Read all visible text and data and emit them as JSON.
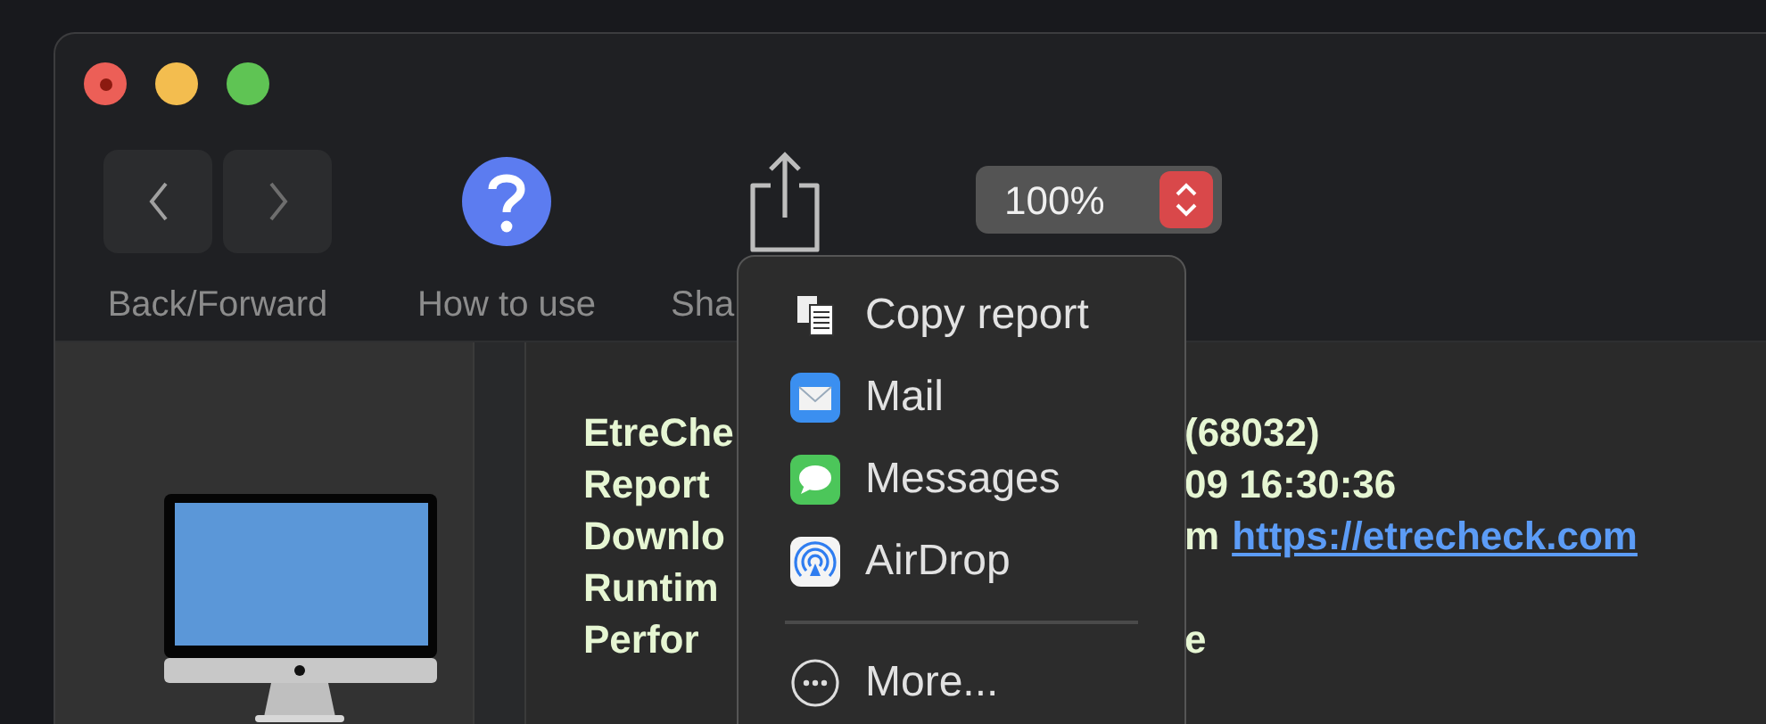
{
  "toolbar": {
    "items": [
      {
        "kind": "nav",
        "label": "Back/Forward"
      },
      {
        "kind": "help",
        "label": "How to use"
      },
      {
        "kind": "share",
        "label": "Sha"
      },
      {
        "kind": "zoom",
        "value": "100%"
      }
    ]
  },
  "report": {
    "lines": [
      {
        "left": "EtreChe",
        "right": "(68032)"
      },
      {
        "left": "Report",
        "right": "09 16:30:36"
      },
      {
        "left": "Downlo",
        "right": "m",
        "link": "https://etrecheck.com"
      },
      {
        "left": "Runtim"
      },
      {
        "left": "Perfor",
        "right": "e"
      }
    ]
  },
  "share_menu": {
    "items": [
      {
        "kind": "copy",
        "label": "Copy report"
      },
      {
        "kind": "mail",
        "label": "Mail"
      },
      {
        "kind": "messages",
        "label": "Messages"
      },
      {
        "kind": "airdrop",
        "label": "AirDrop"
      },
      {
        "kind": "separator"
      },
      {
        "kind": "more",
        "label": "More..."
      }
    ]
  }
}
